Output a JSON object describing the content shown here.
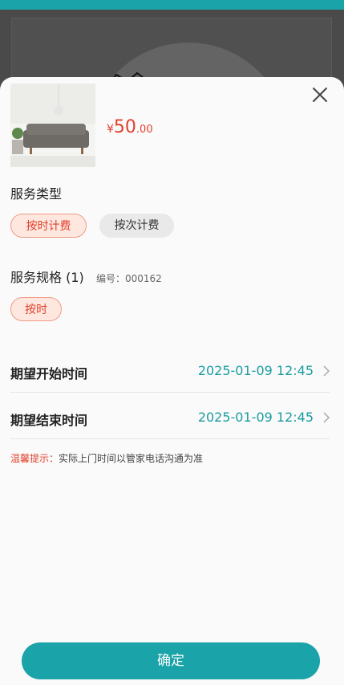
{
  "price": {
    "currency": "¥",
    "integer": "50",
    "decimal": ".00"
  },
  "service_type": {
    "title": "服务类型",
    "options": [
      {
        "label": "按时计费",
        "selected": true
      },
      {
        "label": "按次计费",
        "selected": false
      }
    ]
  },
  "service_spec": {
    "title": "服务规格 (1)",
    "code": "编号：000162",
    "options": [
      {
        "label": "按时",
        "selected": true
      }
    ]
  },
  "start_time": {
    "label": "期望开始时间",
    "value": "2025-01-09 12:45"
  },
  "end_time": {
    "label": "期望结束时间",
    "value": "2025-01-09 12:45"
  },
  "tip": {
    "label": "温馨提示：",
    "text": "实际上门时间以管家电话沟通为准"
  },
  "confirm_label": "确定",
  "colors": {
    "accent": "#1aa3a8",
    "price_red": "#e2412e"
  },
  "icons": {
    "close": "close-icon",
    "chevron": "chevron-right-icon"
  }
}
